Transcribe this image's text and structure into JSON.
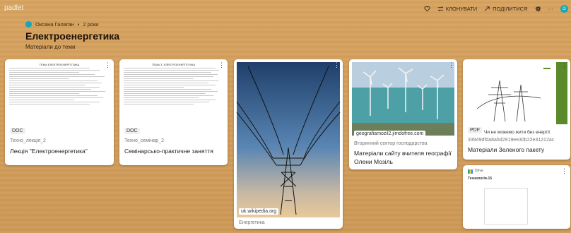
{
  "app": {
    "logo": "padlet"
  },
  "toolbar": {
    "clone_label": "КЛОНУВАТИ",
    "share_label": "ПОДІЛИТИСЯ",
    "more_label": "···",
    "avatar_letter": "О"
  },
  "board": {
    "author": "Оксана Галаган",
    "age": "2 роки",
    "title": "Електроенергетика",
    "subtitle": "Матеріали до теми"
  },
  "cards": [
    {
      "type_badge": "DOC",
      "meta": "Техно_лекція_2",
      "title": "Лекція \"Електроенергетика\"",
      "doc_heading": "ТЕМА ЕЛЕКТРОЕНЕРГЕТИКА"
    },
    {
      "type_badge": "DOC",
      "meta": "Техно_семінар_2",
      "title": "Семінарсько-практичне заняття",
      "doc_heading": "ТЕМА 3. ЕЛЕКТРОЕНЕРГЕТИКА"
    },
    {
      "source": "uk.wikipedia.org",
      "meta": "Енергетика",
      "title": ""
    },
    {
      "source": "geografiamozil2.jimdofree.com",
      "meta": "Вторинний сектор господарства",
      "title": "Матеріали сайту вчителя географії Олени Мозіль"
    },
    {
      "type_badge": "PDF",
      "overlay_text": "Чи не можемо жити без енергії",
      "meta": "33949dfda8a5d2919ee30b22e31212ac",
      "title": "Матеріали Зеленого пакету"
    },
    {
      "drive_label": "Drive",
      "doc_label": "Технологія-15"
    }
  ],
  "colors": {
    "background": "#d2a05c",
    "accent": "#16a6b6"
  }
}
